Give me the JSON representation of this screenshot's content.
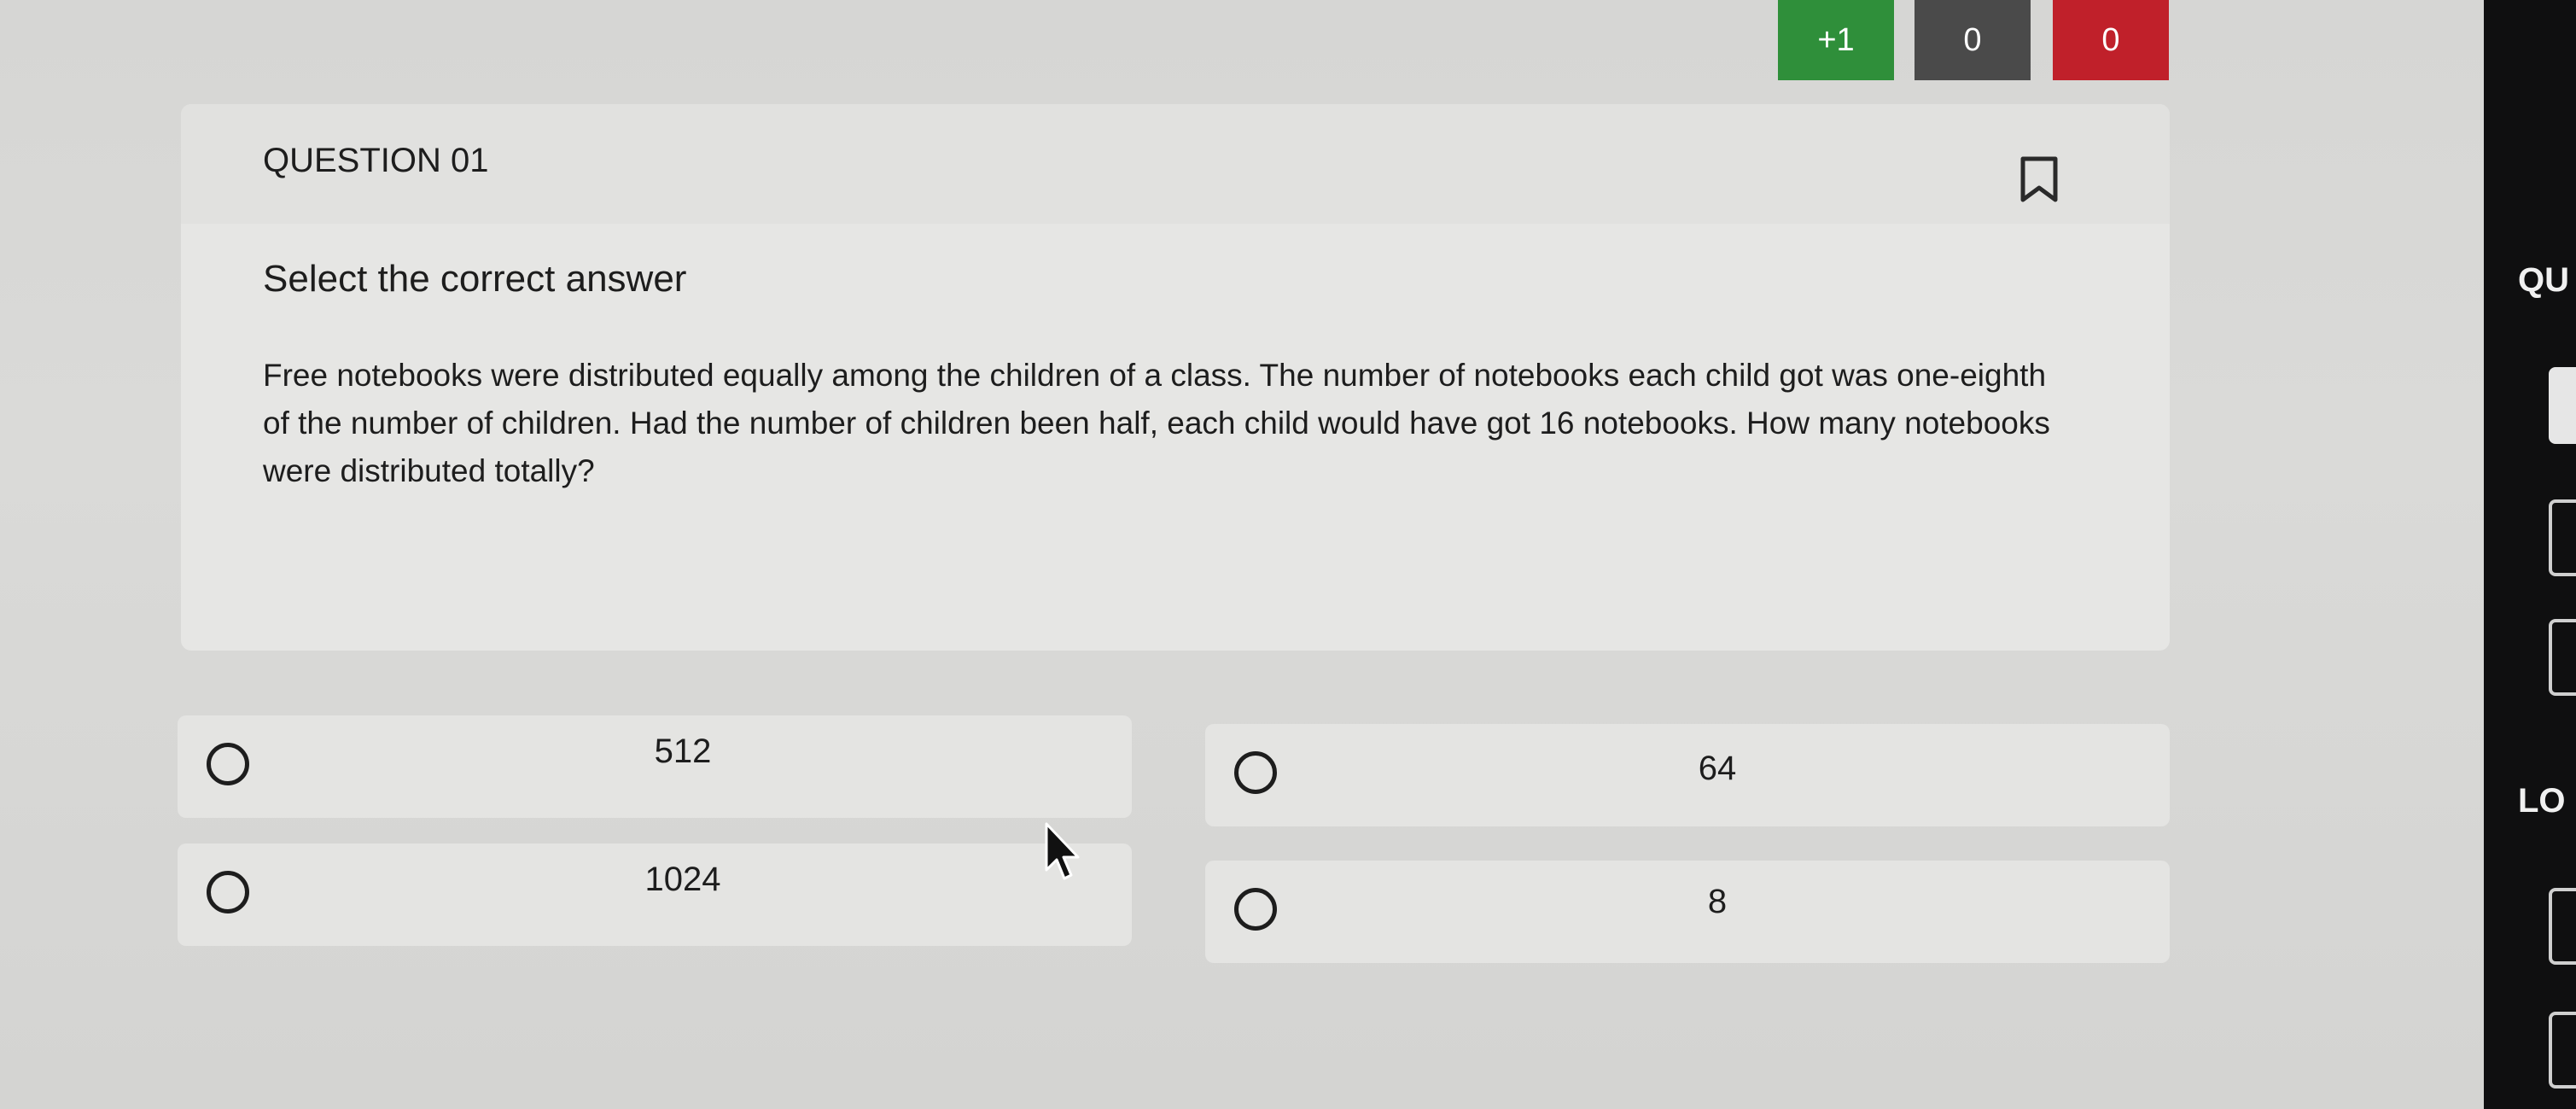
{
  "scoreboard": {
    "correct_marks": "+1",
    "unattempted_marks": "0",
    "negative_marks": "0",
    "colors": {
      "correct": "#2f8f3a",
      "unattempted": "#4a4a4a",
      "negative": "#c0202a"
    }
  },
  "question": {
    "number_label": "QUESTION 01",
    "bookmark_icon": "bookmark-icon",
    "instruction": "Select the correct answer",
    "text": "Free notebooks were distributed equally among the children of a class. The number of notebooks each child got was one-eighth of the number of children. Had the number of children been half, each child would have got 16 notebooks. How many notebooks were distributed totally?"
  },
  "options": [
    {
      "value": "512",
      "selected": false
    },
    {
      "value": "64",
      "selected": false
    },
    {
      "value": "1024",
      "selected": false
    },
    {
      "value": "8",
      "selected": false
    }
  ],
  "side_panel": {
    "label_1": "QU",
    "label_2": "LO"
  }
}
